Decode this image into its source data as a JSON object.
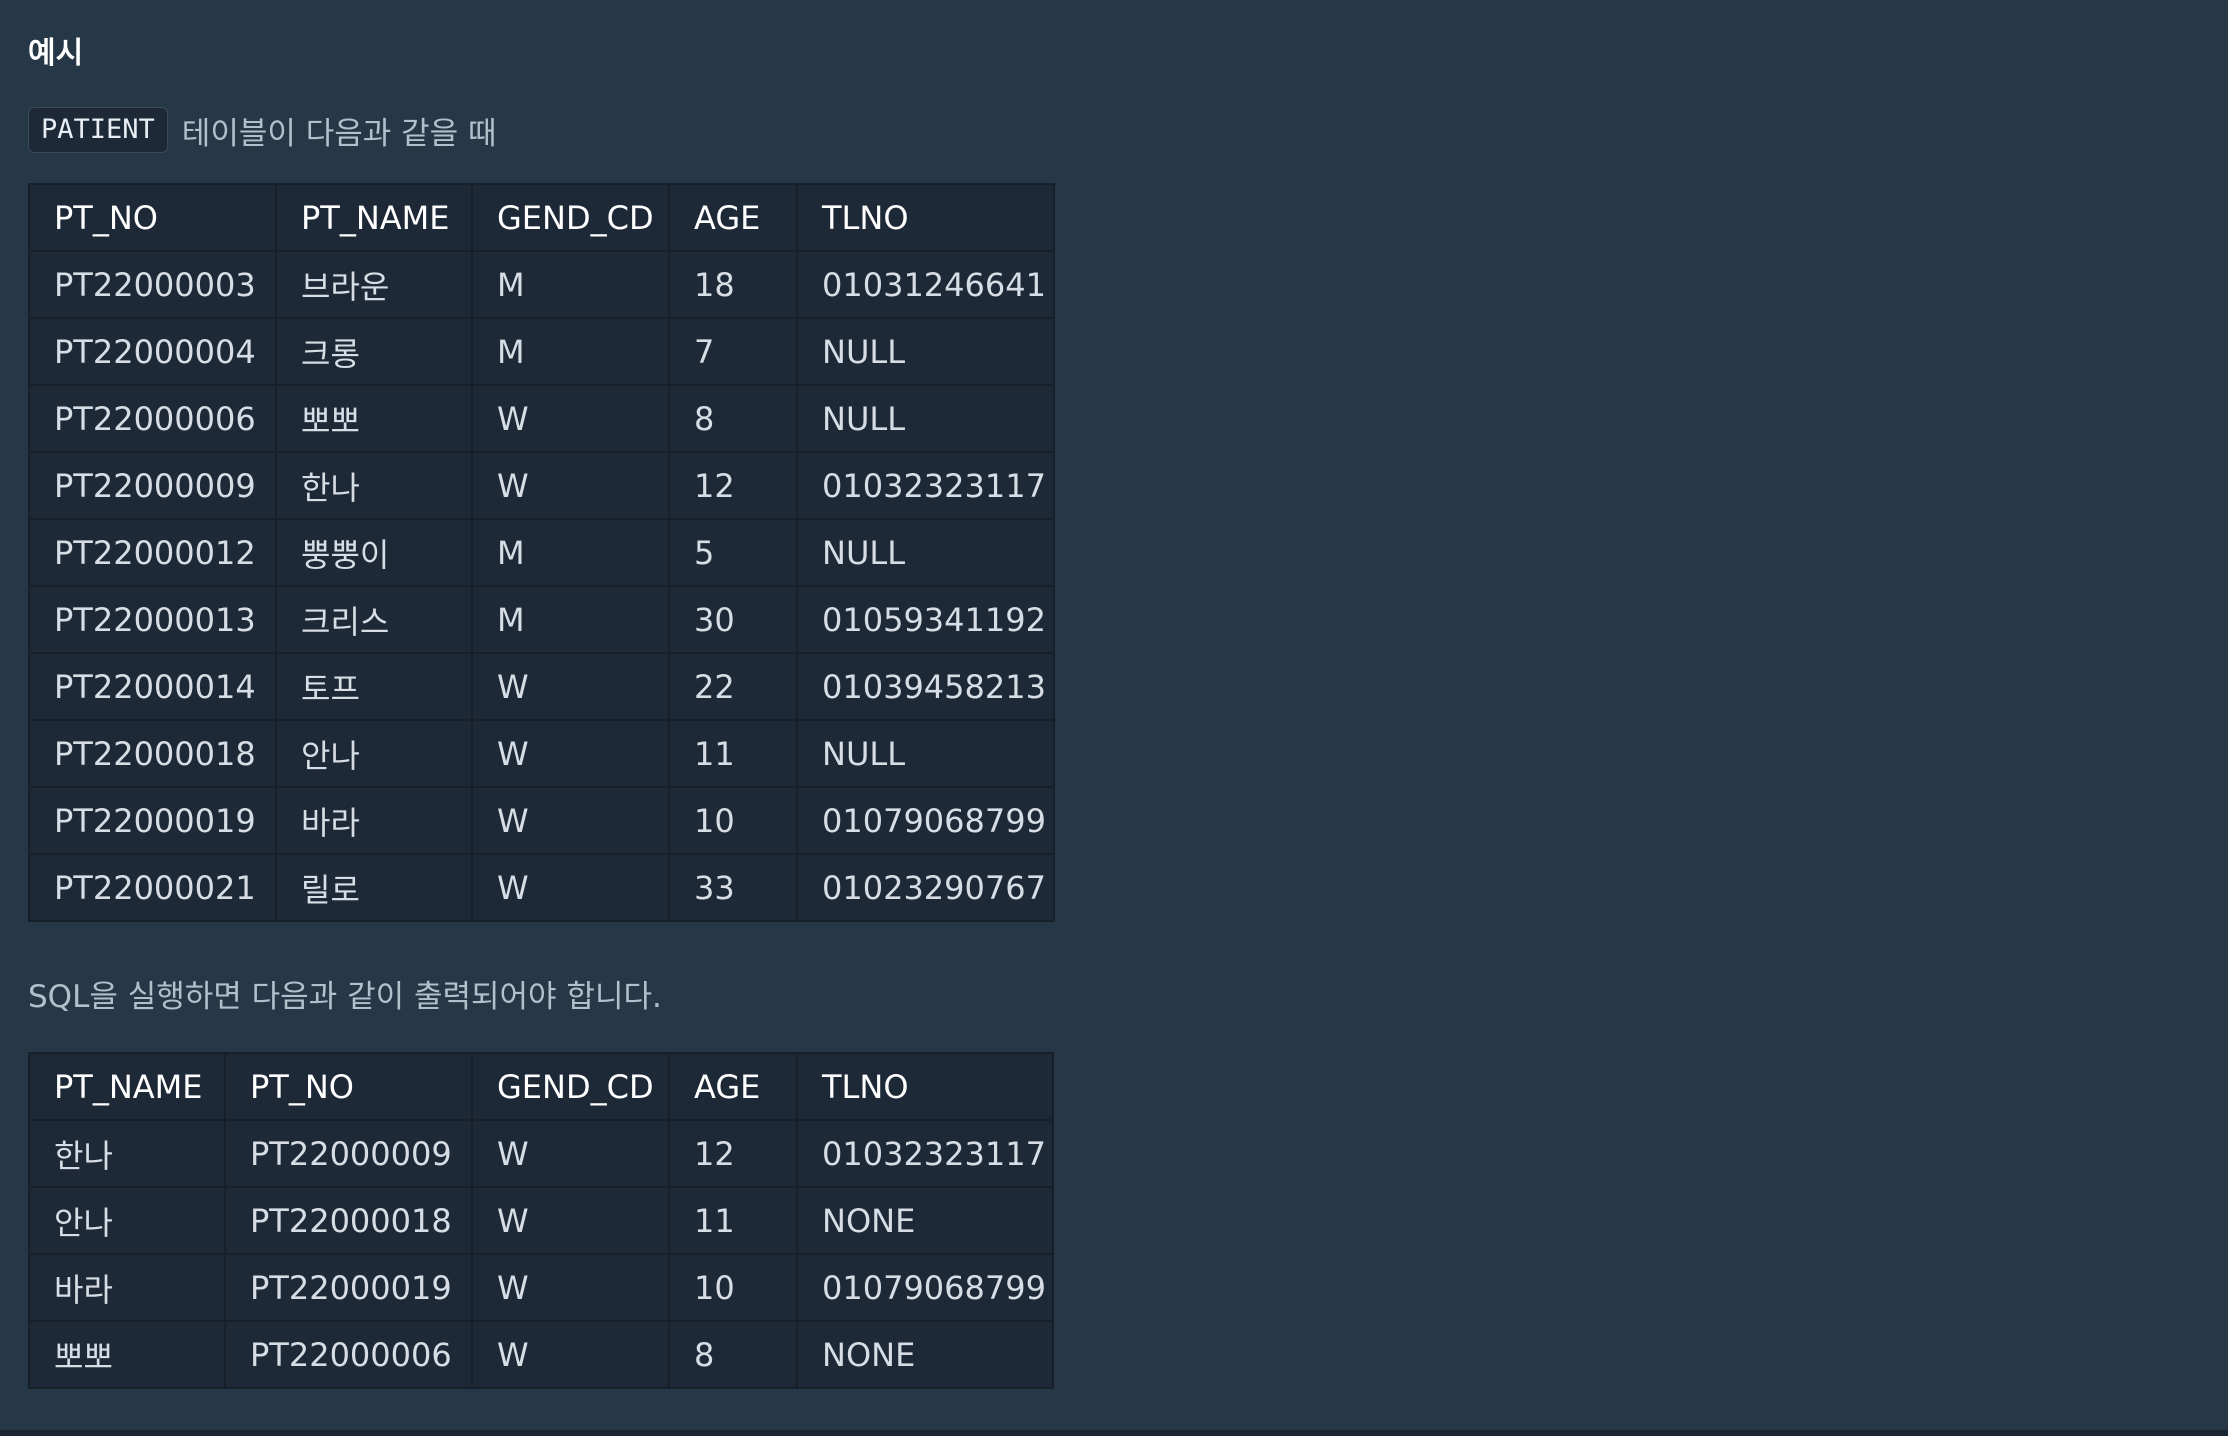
{
  "heading": "예시",
  "intro": {
    "table_name": "PATIENT",
    "text": "테이블이 다음과 같을 때"
  },
  "patient_table": {
    "columns": [
      "PT_NO",
      "PT_NAME",
      "GEND_CD",
      "AGE",
      "TLNO"
    ],
    "rows": [
      [
        "PT22000003",
        "브라운",
        "M",
        "18",
        "01031246641"
      ],
      [
        "PT22000004",
        "크롱",
        "M",
        "7",
        "NULL"
      ],
      [
        "PT22000006",
        "뽀뽀",
        "W",
        "8",
        "NULL"
      ],
      [
        "PT22000009",
        "한나",
        "W",
        "12",
        "01032323117"
      ],
      [
        "PT22000012",
        "뿡뿡이",
        "M",
        "5",
        "NULL"
      ],
      [
        "PT22000013",
        "크리스",
        "M",
        "30",
        "01059341192"
      ],
      [
        "PT22000014",
        "토프",
        "W",
        "22",
        "01039458213"
      ],
      [
        "PT22000018",
        "안나",
        "W",
        "11",
        "NULL"
      ],
      [
        "PT22000019",
        "바라",
        "W",
        "10",
        "01079068799"
      ],
      [
        "PT22000021",
        "릴로",
        "W",
        "33",
        "01023290767"
      ]
    ]
  },
  "result_caption": "SQL을 실행하면 다음과 같이 출력되어야 합니다.",
  "result_table": {
    "columns": [
      "PT_NAME",
      "PT_NO",
      "GEND_CD",
      "AGE",
      "TLNO"
    ],
    "rows": [
      [
        "한나",
        "PT22000009",
        "W",
        "12",
        "01032323117"
      ],
      [
        "안나",
        "PT22000018",
        "W",
        "11",
        "NONE"
      ],
      [
        "바라",
        "PT22000019",
        "W",
        "10",
        "01079068799"
      ],
      [
        "뽀뽀",
        "PT22000006",
        "W",
        "8",
        "NONE"
      ]
    ]
  },
  "colors": {
    "background": "#263747",
    "table_background": "#1e2937",
    "table_border": "#172029",
    "text": "#d6dde4",
    "muted_text": "#b2c0cc"
  }
}
